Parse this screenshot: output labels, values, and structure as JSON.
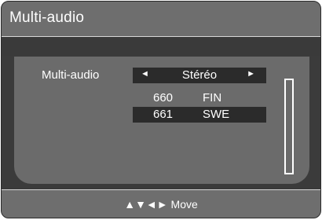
{
  "window": {
    "title": "Multi-audio"
  },
  "setting": {
    "label": "Multi-audio",
    "left_arrow": "◄",
    "value": "Stéréo",
    "right_arrow": "►"
  },
  "audio_tracks": [
    {
      "number": "660",
      "language": "FIN"
    },
    {
      "number": "661",
      "language": "SWE"
    }
  ],
  "footer": {
    "hint": "▲▼◄► Move"
  },
  "colors": {
    "header_bg": "#6e6e6e",
    "panel_bg": "#6b6b6b",
    "frame_bg": "#3b3b3b",
    "highlight_bg": "#2b2b2b",
    "text": "#ffffff"
  }
}
